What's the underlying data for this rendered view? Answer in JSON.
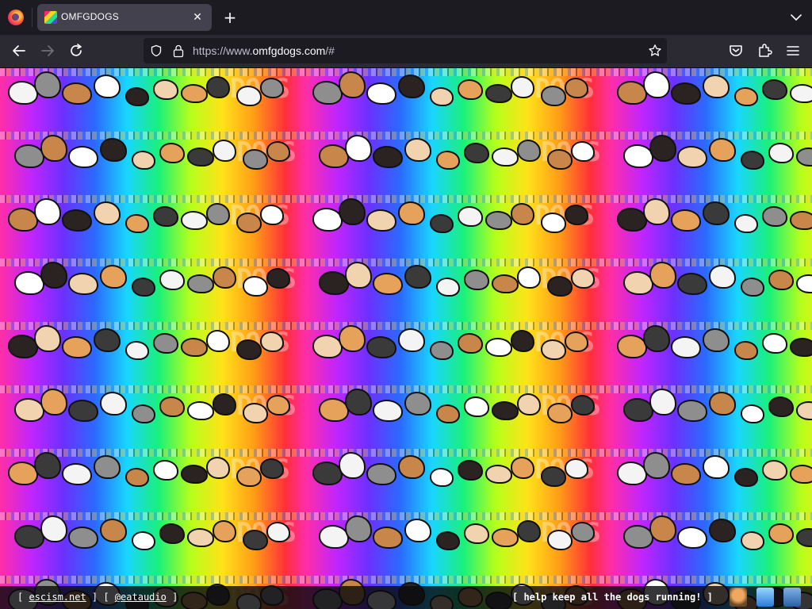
{
  "browser": {
    "tab": {
      "title": "OMFGDOGS",
      "close_glyph": "✕"
    },
    "new_tab_glyph": "+",
    "url": {
      "prefix": "https://www.",
      "domain": "omfgdogs.com",
      "suffix": "/#"
    },
    "icons": {
      "app": "firefox-logo",
      "back": "back-arrow-icon",
      "forward": "forward-arrow-icon",
      "reload": "reload-icon",
      "shield": "tracking-shield-icon",
      "lock": "lock-icon",
      "bookmark": "star-icon",
      "pocket": "pocket-icon",
      "extensions": "extensions-icon",
      "menu": "hamburger-menu-icon",
      "tab_list": "chevron-down-icon"
    }
  },
  "page": {
    "background_word": "DOGS",
    "footer": {
      "left_open": "[ ",
      "link1": "escism.net",
      "mid": " ] [ ",
      "link2": "@eataudio",
      "left_close": " ]",
      "right": "[ help keep all the dogs running! ]",
      "icons": [
        "cat-icon",
        "bitcoin-logo-icon",
        "paypal-dog-icon"
      ]
    }
  },
  "colors": {
    "toolbar": "#2b2a33",
    "tabstrip": "#1c1b22",
    "active_tab": "#42414d",
    "url_field": "#1c1b22"
  }
}
